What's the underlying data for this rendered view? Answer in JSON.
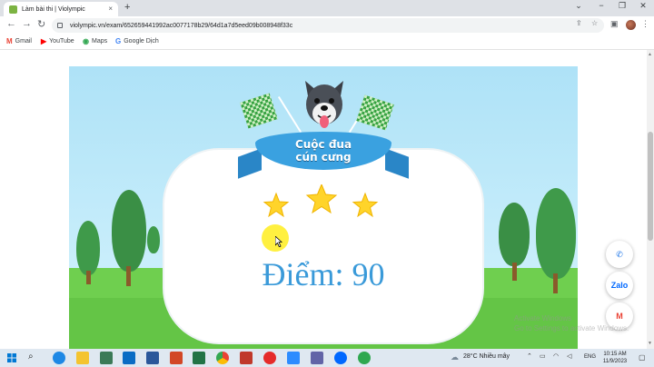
{
  "browser": {
    "tab_title": "Làm bài thi | Violympic",
    "tab_close": "×",
    "new_tab": "+",
    "url": "violympic.vn/exam/652659441992ac0077178b29/64d1a7d5eed09b008948f33c",
    "window_controls": [
      "⌄",
      "−",
      "❐",
      "✕"
    ]
  },
  "bookmarks": [
    {
      "label": "Gmail",
      "icon": "gmail-icon",
      "glyph": "M",
      "color": "#ea4335"
    },
    {
      "label": "YouTube",
      "icon": "youtube-icon",
      "glyph": "▶",
      "color": "#ff0000"
    },
    {
      "label": "Maps",
      "icon": "maps-icon",
      "glyph": "◉",
      "color": "#34a853"
    },
    {
      "label": "Google Dịch",
      "icon": "translate-icon",
      "glyph": "G",
      "color": "#4285f4"
    }
  ],
  "game": {
    "banner_line1": "Cuộc đua",
    "banner_line2": "cún cưng",
    "score_text": "Điểm: 90",
    "stars_earned": 3,
    "star_color": "#ffd42a"
  },
  "floating": {
    "phone_glyph": "✆",
    "zalo_label": "Zalo",
    "gmail_glyph": "M"
  },
  "watermark": {
    "line1": "Activate Windows",
    "line2": "Go to Settings to activate Windows."
  },
  "taskbar": {
    "weather": "28°C  Nhiều mây",
    "lang": "ENG",
    "time": "10:15 AM",
    "date": "11/9/2023"
  },
  "colors": {
    "sky": "#aee2f7",
    "grass": "#6fcf4f",
    "accent_blue": "#3a9ad9",
    "tree_green": "#3f9a4a"
  }
}
